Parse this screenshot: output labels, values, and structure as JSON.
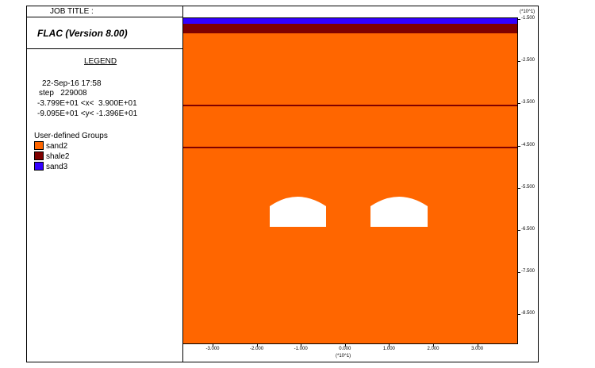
{
  "header": {
    "job_title_label": "JOB TITLE :",
    "version": "FLAC (Version 8.00)"
  },
  "legend": {
    "title": "LEGEND",
    "date": "22-Sep-16 17:58",
    "step": "step   229008",
    "x_range": "-3.799E+01 <x<  3.900E+01",
    "y_range": "-9.095E+01 <y< -1.396E+01",
    "groups_title": "User-defined Groups",
    "groups": [
      {
        "name": "sand2",
        "color": "#ff6600"
      },
      {
        "name": "shale2",
        "color": "#7f0000"
      },
      {
        "name": "sand3",
        "color": "#3300ff"
      }
    ]
  },
  "plot": {
    "colors": {
      "sand2": "#ff6600",
      "shale2": "#7f0000",
      "sand3": "#3300ff",
      "excavation": "#ffffff",
      "interface": "#7f0000"
    },
    "y_exponent": "(*10^1)",
    "x_exponent": "(*10^1)",
    "y_ticks": [
      "-1.500",
      "-2.500",
      "-3.500",
      "-4.500",
      "-5.500",
      "-6.500",
      "-7.500",
      "-8.500"
    ],
    "x_ticks": [
      "-3.000",
      "-2.000",
      "-1.000",
      "0.000",
      "1.000",
      "2.000",
      "3.000"
    ]
  }
}
